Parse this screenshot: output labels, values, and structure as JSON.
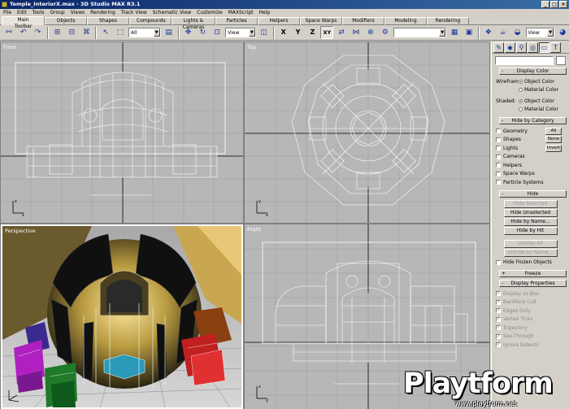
{
  "window": {
    "title": "Temple_InteriorX.max - 3D Studio MAX R3.1"
  },
  "menu": [
    "File",
    "Edit",
    "Tools",
    "Group",
    "Views",
    "Rendering",
    "Track View",
    "Schematic View",
    "Customize",
    "MAXScript",
    "Help"
  ],
  "tabs": [
    "Main Toolbar",
    "Objects",
    "Shapes",
    "Compounds",
    "Lights & Cameras",
    "Particles",
    "Helpers",
    "Space Warps",
    "Modifiers",
    "Modeling",
    "Rendering"
  ],
  "toolbar": {
    "selection_filter": "All",
    "ref_coord": "View",
    "axis_x": "X",
    "axis_y": "Y",
    "axis_z": "Z",
    "axis_xy": "XY",
    "named_selection": "",
    "view_combo": "View"
  },
  "viewports": {
    "front": "Front",
    "top": "Top",
    "perspective": "Perspective",
    "right": "Right"
  },
  "panel": {
    "display_color": {
      "title": "Display Color",
      "wireframe_label": "Wireframe:",
      "shaded_label": "Shaded:",
      "object_color": "Object Color",
      "material_color": "Material Color"
    },
    "hide_by_category": {
      "title": "Hide by Category",
      "items": [
        "Geometry",
        "Shapes",
        "Lights",
        "Cameras",
        "Helpers",
        "Space Warps",
        "Particle Systems"
      ],
      "all": "All",
      "none": "None",
      "invert": "Invert"
    },
    "hide": {
      "title": "Hide",
      "hide_selected": "Hide Selected",
      "hide_unselected": "Hide Unselected",
      "hide_by_name": "Hide by Name...",
      "hide_by_hit": "Hide by Hit",
      "unhide_all": "Unhide All",
      "unhide_by_name": "Unhide by Name...",
      "hide_frozen": "Hide Frozen Objects"
    },
    "freeze": {
      "title": "Freeze"
    },
    "display_properties": {
      "title": "Display Properties",
      "items": [
        "Display as Box",
        "Backface Cull",
        "Edges Only",
        "Vertex Ticks",
        "Trajectory",
        "See-Through",
        "Ignore Extents"
      ]
    }
  },
  "watermark": {
    "brand": "Playtform",
    "url": "www.playtform.net"
  },
  "colors": {
    "title_blue": "#0a246a",
    "ui_gray": "#d4d0c8",
    "viewport_gray": "#b7b7b7"
  }
}
